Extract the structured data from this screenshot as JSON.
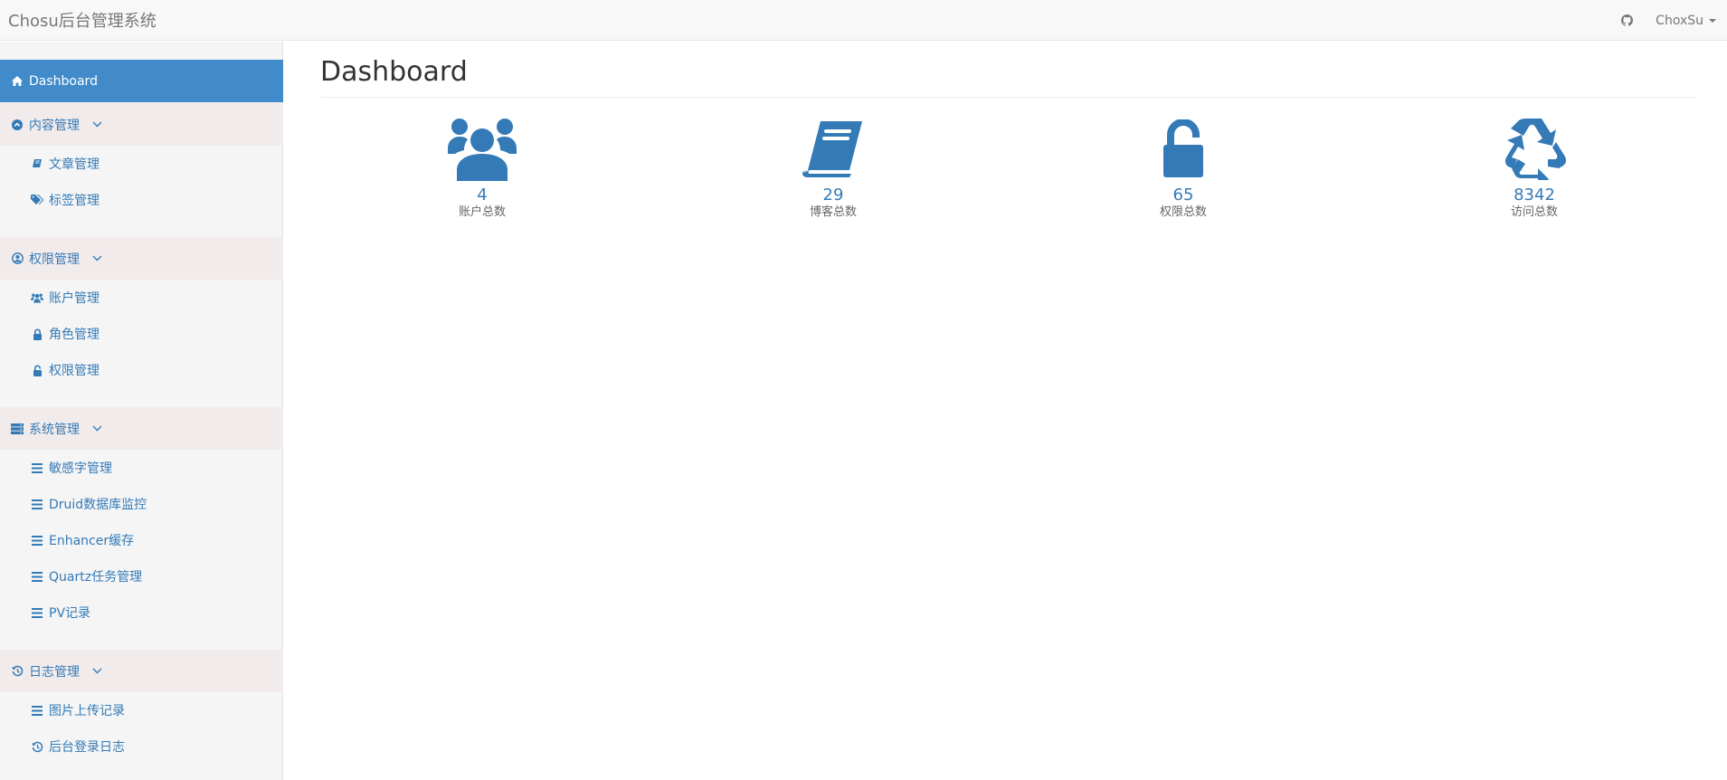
{
  "navbar": {
    "brand": "Chosu后台管理系统",
    "user": "ChoxSu"
  },
  "sidebar": {
    "active": "Dashboard",
    "groups": [
      {
        "label": "内容管理",
        "items": [
          "文章管理",
          "标签管理"
        ]
      },
      {
        "label": "权限管理",
        "items": [
          "账户管理",
          "角色管理",
          "权限管理"
        ]
      },
      {
        "label": "系统管理",
        "items": [
          "敏感字管理",
          "Druid数据库监控",
          "Enhancer缓存",
          "Quartz任务管理",
          "PV记录"
        ]
      },
      {
        "label": "日志管理",
        "items": [
          "图片上传记录",
          "后台登录日志"
        ]
      }
    ]
  },
  "main": {
    "title": "Dashboard",
    "stats": [
      {
        "value": "4",
        "label": "账户总数",
        "icon": "users-icon"
      },
      {
        "value": "29",
        "label": "博客总数",
        "icon": "book-icon"
      },
      {
        "value": "65",
        "label": "权限总数",
        "icon": "unlock-icon"
      },
      {
        "value": "8342",
        "label": "访问总数",
        "icon": "recycle-icon"
      }
    ]
  },
  "colors": {
    "accent": "#428bca",
    "link": "#337ab7",
    "group_bg": "#f2ebeb",
    "sidebar_bg": "#f5f5f5"
  }
}
